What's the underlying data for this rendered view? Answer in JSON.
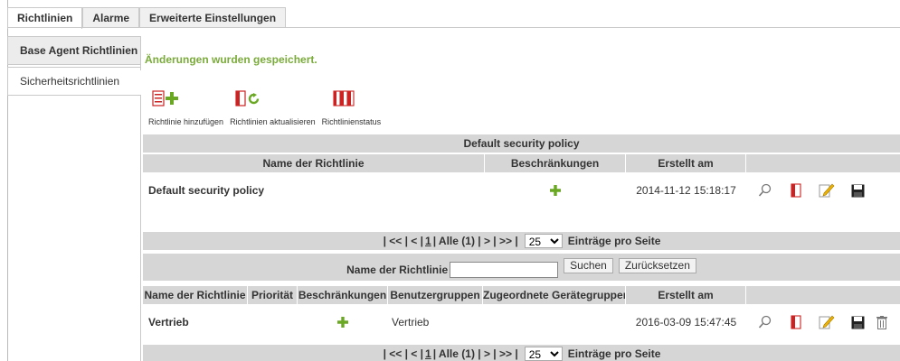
{
  "top_tabs": [
    {
      "label": "Richtlinien",
      "active": true
    },
    {
      "label": "Alarme",
      "active": false
    },
    {
      "label": "Erweiterte Einstellungen",
      "active": false
    }
  ],
  "side_tabs": [
    {
      "label": "Base Agent Richtlinien",
      "active": false
    },
    {
      "label": "Sicherheitsrichtlinien",
      "active": true
    }
  ],
  "message": "Änderungen wurden gespeichert.",
  "toolbar": {
    "add_label": "Richtlinie hinzufügen",
    "refresh_label": "Richtlinien aktualisieren",
    "status_label": "Richtlinienstatus"
  },
  "default_section": {
    "title": "Default security policy",
    "headers": {
      "name": "Name der Richtlinie",
      "restrictions": "Beschränkungen",
      "created": "Erstellt am"
    },
    "row": {
      "name": "Default security policy",
      "created": "2014-11-12 15:18:17"
    }
  },
  "pager": {
    "prefix": "| << | < |",
    "current": "1",
    "middle": "| Alle (1) | > | >> |",
    "page_size": "25",
    "suffix": "Einträge pro Seite"
  },
  "search": {
    "label": "Name der Richtlinie",
    "value": "",
    "search_button": "Suchen",
    "reset_button": "Zurücksetzen"
  },
  "policies": {
    "headers": {
      "name": "Name der Richtlinie",
      "priority": "Priorität",
      "restrictions": "Beschränkungen",
      "user_groups": "Benutzergruppen",
      "device_groups": "Zugeordnete Gerätegruppen",
      "created": "Erstellt am"
    },
    "rows": [
      {
        "name": "Vertrieb",
        "priority": "",
        "user_groups": "Vertrieb",
        "device_groups": "",
        "created": "2016-03-09 15:47:45"
      }
    ]
  },
  "colors": {
    "success": "#7aab3a",
    "header_bg": "#d6d6d6",
    "plus_green": "#6aa823",
    "doc_red": "#cc2222"
  }
}
